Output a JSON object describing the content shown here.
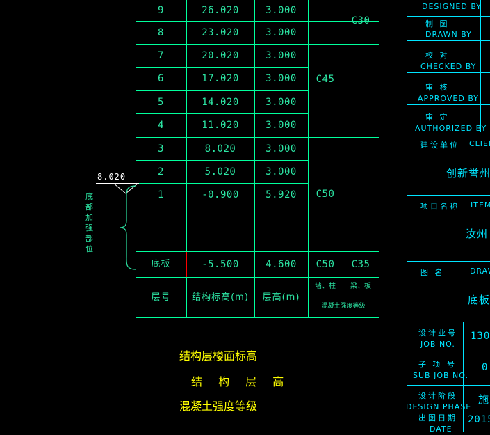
{
  "drawing": {
    "title": "结构层楼面标高结构层高混凝土强度等级表",
    "colors": {
      "table_line": "#00ff9c",
      "table_text": "#2ce6a4",
      "legend_text": "#ffff00",
      "titleblock": "#00e5ff",
      "callout": "#ffffff",
      "marker": "#ff0000",
      "background": "#000000"
    }
  },
  "table": {
    "headers": {
      "floor": "层号",
      "elevation": "结构标高(m)",
      "height": "层高(m)",
      "wall_column": "墙、柱",
      "beam_slab": "梁、板",
      "concrete_grade": "混凝土强度等级"
    },
    "rows": [
      {
        "floor": "9",
        "elevation": "26.020",
        "height": "3.000"
      },
      {
        "floor": "8",
        "elevation": "23.020",
        "height": "3.000"
      },
      {
        "floor": "7",
        "elevation": "20.020",
        "height": "3.000"
      },
      {
        "floor": "6",
        "elevation": "17.020",
        "height": "3.000"
      },
      {
        "floor": "5",
        "elevation": "14.020",
        "height": "3.000"
      },
      {
        "floor": "4",
        "elevation": "11.020",
        "height": "3.000"
      },
      {
        "floor": "3",
        "elevation": "8.020",
        "height": "3.000"
      },
      {
        "floor": "2",
        "elevation": "5.020",
        "height": "3.000"
      },
      {
        "floor": "1",
        "elevation": "-0.900",
        "height": "5.920"
      },
      {
        "floor": "底板",
        "elevation": "-5.500",
        "height": "4.600"
      }
    ],
    "grades": {
      "wall_column_upper": "C45",
      "wall_column_lower": "C50",
      "wall_column_base": "C50",
      "beam_slab_upper": "C30",
      "beam_slab_base": "C35"
    }
  },
  "callout": {
    "elevation": "8.020",
    "note": "底部加强部位"
  },
  "legend": {
    "line1": "结构层楼面标高",
    "line2": "结 构 层 高",
    "line3": "混凝土强度等级"
  },
  "title_block": {
    "signatures": [
      {
        "cn": "",
        "en": "DESIGNED BY"
      },
      {
        "cn": "制    图",
        "en": "DRAWN BY"
      },
      {
        "cn": "校    对",
        "en": "CHECKED BY"
      },
      {
        "cn": "审    核",
        "en": "APPROVED BY"
      },
      {
        "cn": "审    定",
        "en": "AUTHORIZED BY"
      }
    ],
    "client": {
      "cn": "建设单位",
      "en": "CLIENT",
      "value": "创新誉州"
    },
    "item": {
      "cn": "项目名称",
      "en": "ITEM",
      "value": "汝州"
    },
    "drawing_name": {
      "cn": "图    名",
      "en": "DRAW",
      "value": "底板面"
    },
    "job_no": {
      "cn": "设计业号",
      "en": "JOB NO.",
      "value": "130"
    },
    "sub_job_no": {
      "cn": "子 项 号",
      "en": "SUB JOB NO.",
      "value": "0"
    },
    "design_phase": {
      "cn": "设计阶段",
      "en": "DESIGN PHASE",
      "value": "施"
    },
    "date": {
      "cn": "出图日期",
      "en": "DATE",
      "value": "2015"
    }
  }
}
